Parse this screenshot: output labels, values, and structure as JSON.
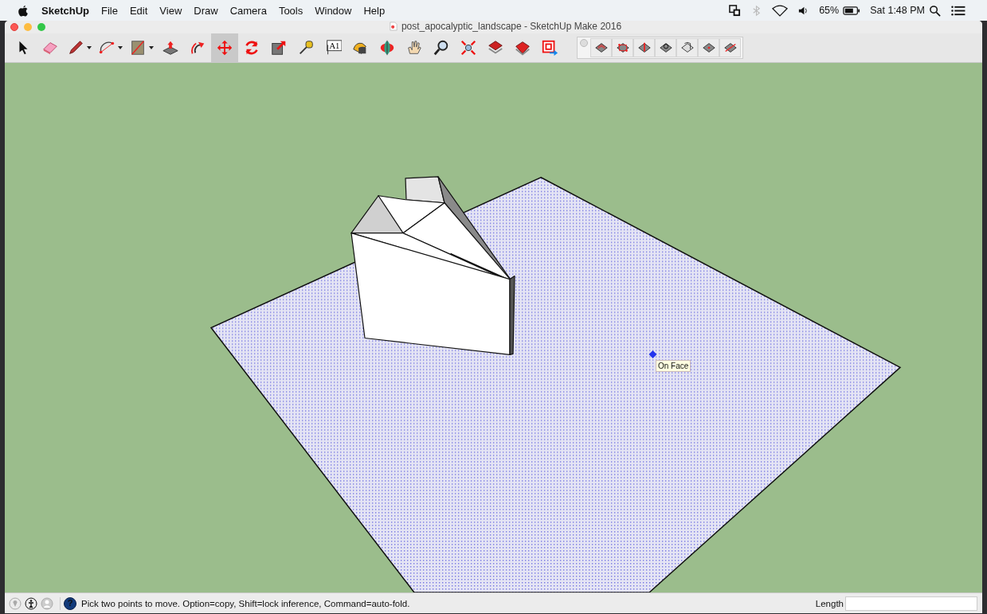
{
  "menu_bar": {
    "app_name": "SketchUp",
    "menus": [
      "File",
      "Edit",
      "View",
      "Draw",
      "Camera",
      "Tools",
      "Window",
      "Help"
    ],
    "battery": "65%",
    "clock": "Sat 1:48 PM"
  },
  "window": {
    "title": "post_apocalyptic_landscape - SketchUp Make 2016"
  },
  "toolbar": {
    "tools": [
      {
        "selected": false,
        "dropdown": false
      },
      {
        "selected": false,
        "dropdown": false
      },
      {
        "selected": false,
        "dropdown": true
      },
      {
        "selected": false,
        "dropdown": true
      },
      {
        "selected": false,
        "dropdown": true
      },
      {
        "selected": false,
        "dropdown": false
      },
      {
        "selected": false,
        "dropdown": false
      },
      {
        "selected": true,
        "dropdown": false
      },
      {
        "selected": false,
        "dropdown": false
      },
      {
        "selected": false,
        "dropdown": false
      },
      {
        "selected": false,
        "dropdown": false
      },
      {
        "selected": false,
        "dropdown": false
      },
      {
        "selected": false,
        "dropdown": false
      },
      {
        "selected": false,
        "dropdown": false
      },
      {
        "selected": false,
        "dropdown": false
      },
      {
        "selected": false,
        "dropdown": false
      },
      {
        "selected": false,
        "dropdown": false
      },
      {
        "selected": false,
        "dropdown": false
      },
      {
        "selected": false,
        "dropdown": false
      },
      {
        "selected": false,
        "dropdown": false
      }
    ],
    "text_tool_label": "A1"
  },
  "sandbox_toolbar": {
    "tools": [
      {
        "selected": false
      },
      {
        "selected": false
      },
      {
        "selected": false
      },
      {
        "selected": false
      },
      {
        "selected": false
      },
      {
        "selected": false
      },
      {
        "selected": false
      }
    ]
  },
  "viewport": {
    "tooltip": "On Face"
  },
  "status_bar": {
    "help_button": "?",
    "message": "Pick two points to move.  Option=copy, Shift=lock inference, Command=auto-fold.",
    "measurement_label": "Length"
  }
}
